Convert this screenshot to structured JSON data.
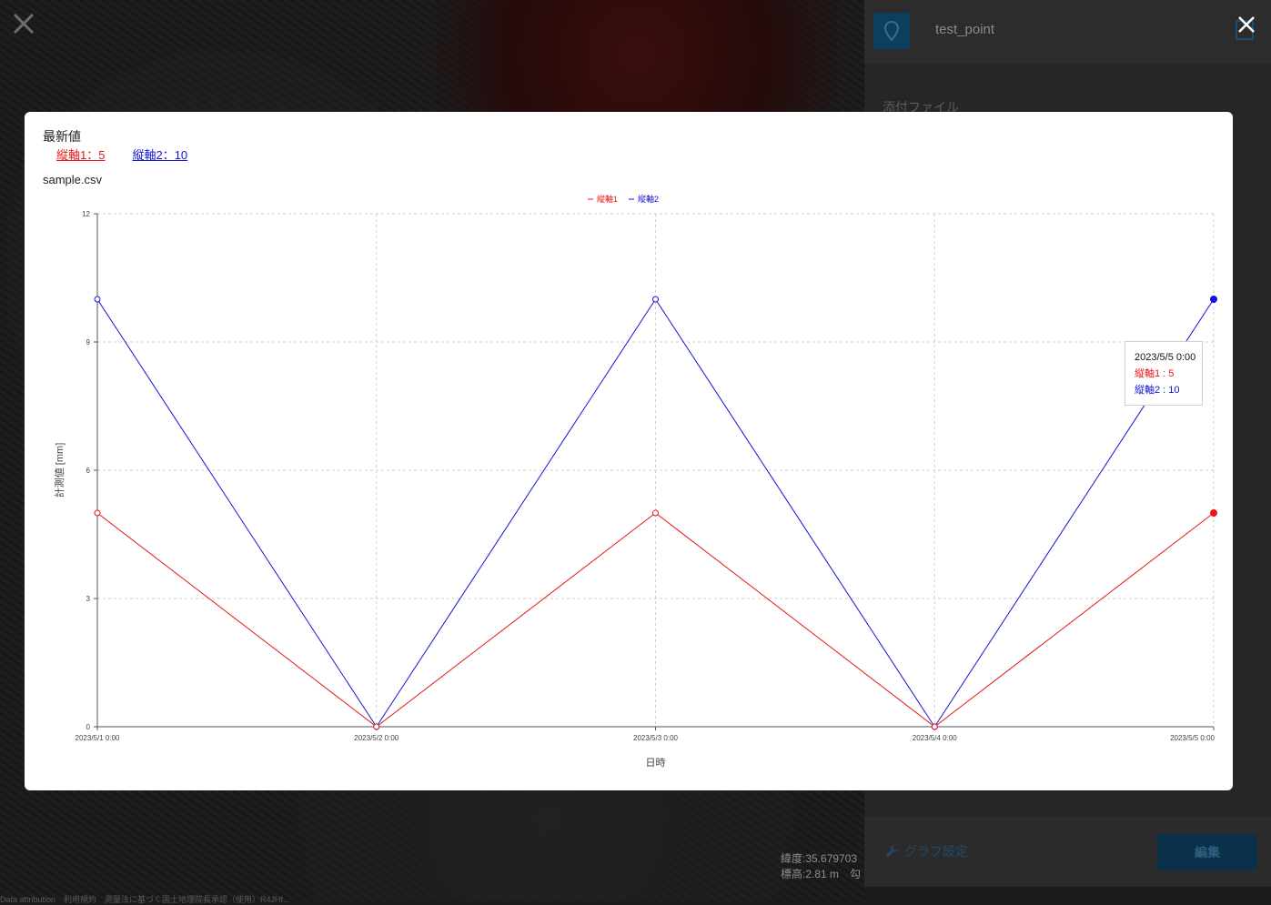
{
  "panel": {
    "title": "test_point",
    "section_label": "添付ファイル",
    "graph_settings_label": "グラフ設定",
    "edit_label": "編集"
  },
  "map": {
    "latitude_label": "緯度:35.679703",
    "elevation_label": "標高:2.81 m　勾",
    "attribution": "Data attribution　利用規約　測量法に基づく国土地理院長承認（使用）R4JHf..."
  },
  "modal": {
    "latest_title": "最新値",
    "latest_s1": "縦軸1：5",
    "latest_s2": "縦軸2：10",
    "file_name": "sample.csv"
  },
  "tooltip": {
    "date": "2023/5/5 0:00",
    "s1": "縦軸1 : 5",
    "s2": "縦軸2 : 10"
  },
  "colors": {
    "series1": "#e81616",
    "series2": "#1414d6"
  },
  "chart_data": {
    "type": "line",
    "x": [
      "2023/5/1 0:00",
      "2023/5/2 0:00",
      "2023/5/3 0:00",
      "2023/5/4 0:00",
      "2023/5/5 0:00"
    ],
    "series": [
      {
        "name": "縦軸1",
        "values": [
          5,
          0,
          5,
          0,
          5
        ]
      },
      {
        "name": "縦軸2",
        "values": [
          10,
          0,
          10,
          0,
          10
        ]
      }
    ],
    "xlabel": "日時",
    "ylabel": "計測値 [mm]",
    "ylim": [
      0,
      12
    ],
    "yticks": [
      0,
      3,
      6,
      9,
      12
    ],
    "grid": true,
    "legend": "top-center",
    "highlighted_index": 4
  }
}
